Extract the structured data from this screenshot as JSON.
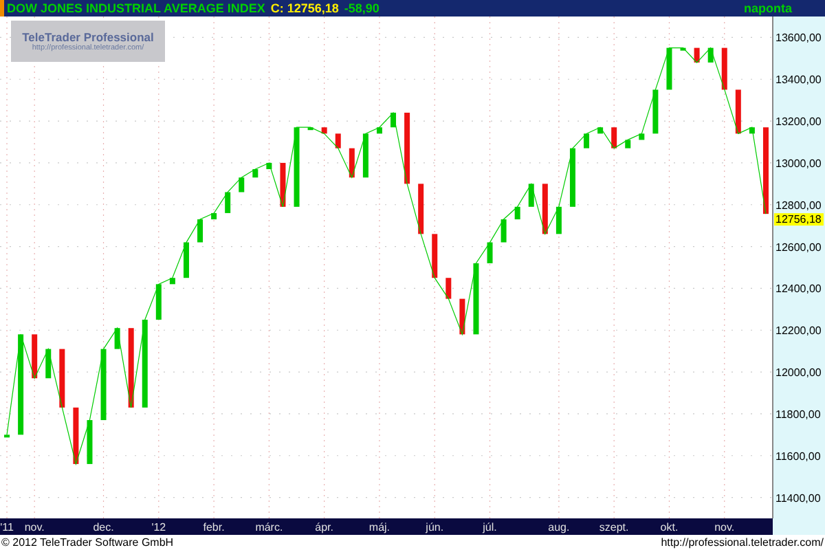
{
  "header": {
    "title": "DOW JONES INDUSTRIAL AVERAGE INDEX",
    "close": "C: 12756,18",
    "change": "-58,90",
    "interval": "naponta"
  },
  "logo": {
    "name": "TeleTrader Professional",
    "url": "http://professional.teletrader.com/"
  },
  "chart": {
    "last_price": "12756,18",
    "chart_data": {
      "type": "line",
      "categories": [
        "'11",
        null,
        "nov.",
        null,
        null,
        null,
        null,
        "dec.",
        null,
        null,
        null,
        "'12",
        null,
        null,
        null,
        "febr.",
        null,
        null,
        null,
        "márc.",
        null,
        null,
        null,
        "ápr.",
        null,
        null,
        null,
        "máj.",
        null,
        null,
        null,
        "jún.",
        null,
        null,
        null,
        "júl.",
        null,
        null,
        null,
        null,
        "aug.",
        null,
        null,
        null,
        "szept.",
        null,
        null,
        null,
        "okt.",
        null,
        null,
        null,
        "nov.",
        null,
        null,
        null
      ],
      "series": [
        {
          "color": "#00cc00",
          "values": [
            11700,
            12180,
            11970,
            12110,
            11830,
            11560,
            11770,
            12110,
            12210,
            11830,
            12250,
            12420,
            12450,
            12620,
            12730,
            12760,
            12860,
            12930,
            12970,
            13000,
            12790,
            13170,
            13170,
            13140,
            13070,
            12930,
            13140,
            13170,
            13240,
            12900,
            12660,
            12450,
            12350,
            12180,
            12520,
            12620,
            12730,
            12790,
            12900,
            12660,
            12790,
            13070,
            13140,
            13170,
            13070,
            13110,
            13140,
            13350,
            13550,
            13550,
            13480,
            13550,
            13350,
            13140,
            13170,
            12756
          ]
        }
      ],
      "ylim": [
        11300,
        13700
      ],
      "grid": true,
      "yticks": [
        {
          "value": 11400,
          "label": "11400,00"
        },
        {
          "value": 11600,
          "label": "11600,00"
        },
        {
          "value": 11800,
          "label": "11800,00"
        },
        {
          "value": 12000,
          "label": "12000,00"
        },
        {
          "value": 12200,
          "label": "12200,00"
        },
        {
          "value": 12400,
          "label": "12400,00"
        },
        {
          "value": 12600,
          "label": "12600,00"
        },
        {
          "value": 12800,
          "label": "12800,00"
        },
        {
          "value": 13000,
          "label": "13000,00"
        },
        {
          "value": 13200,
          "label": "13200,00"
        },
        {
          "value": 13400,
          "label": "13400,00"
        },
        {
          "value": 13600,
          "label": "13600,00"
        }
      ]
    }
  },
  "footer": {
    "copyright": "© 2012 TeleTrader Software GmbH",
    "url": "http://professional.teletrader.com/"
  }
}
